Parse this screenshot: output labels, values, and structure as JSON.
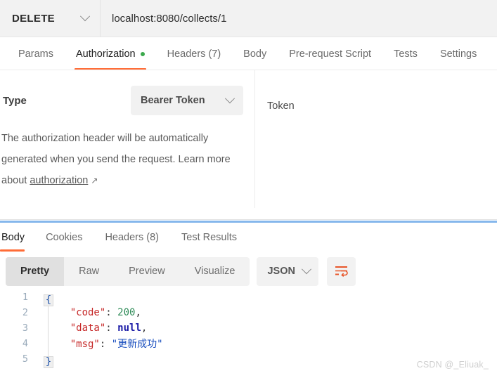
{
  "request_bar": {
    "method": "DELETE",
    "method_chevron_icon": "chevron-down-icon",
    "url": "localhost:8080/collects/1"
  },
  "request_tabs": [
    {
      "label": "Params",
      "active": false,
      "has_dot": false
    },
    {
      "label": "Authorization",
      "active": true,
      "has_dot": true
    },
    {
      "label": "Headers (7)",
      "active": false,
      "has_dot": false
    },
    {
      "label": "Body",
      "active": false,
      "has_dot": false
    },
    {
      "label": "Pre-request Script",
      "active": false,
      "has_dot": false
    },
    {
      "label": "Tests",
      "active": false,
      "has_dot": false
    },
    {
      "label": "Settings",
      "active": false,
      "has_dot": false
    }
  ],
  "auth_panel": {
    "type_label": "Type",
    "type_value": "Bearer Token",
    "type_chevron_icon": "chevron-down-icon",
    "description_prefix": "The authorization header will be automatically generated when you send the request. Learn more about ",
    "description_link": "authorization",
    "external_link_icon": "↗",
    "token_label": "Token"
  },
  "response_tabs": [
    {
      "label": "Body",
      "active": true
    },
    {
      "label": "Cookies",
      "active": false
    },
    {
      "label": "Headers (8)",
      "active": false
    },
    {
      "label": "Test Results",
      "active": false
    }
  ],
  "view_bar": {
    "segments": [
      {
        "label": "Pretty",
        "active": true
      },
      {
        "label": "Raw",
        "active": false
      },
      {
        "label": "Preview",
        "active": false
      },
      {
        "label": "Visualize",
        "active": false
      }
    ],
    "format": "JSON",
    "format_chevron_icon": "chevron-down-icon",
    "wrap_icon": "word-wrap-icon"
  },
  "response_body": {
    "line_numbers": [
      "1",
      "2",
      "3",
      "4",
      "5"
    ],
    "open_brace": "{",
    "close_brace": "}",
    "lines": [
      {
        "key": "\"code\"",
        "sep": ": ",
        "value": "200",
        "value_type": "number",
        "comma": ","
      },
      {
        "key": "\"data\"",
        "sep": ": ",
        "value": "null",
        "value_type": "null",
        "comma": ","
      },
      {
        "key": "\"msg\"",
        "sep": ": ",
        "value": "\"更新成功\"",
        "value_type": "string-cjk",
        "comma": ""
      }
    ]
  },
  "watermark": "CSDN @_Eliuak_",
  "colors": {
    "accent_orange": "#ff6c37",
    "status_dot_green": "#3ba94c",
    "splitter_blue": "#85b7ec",
    "json_key_red": "#c62828",
    "json_number_green": "#2e8b57",
    "json_null_blue": "#1a1aa6"
  }
}
